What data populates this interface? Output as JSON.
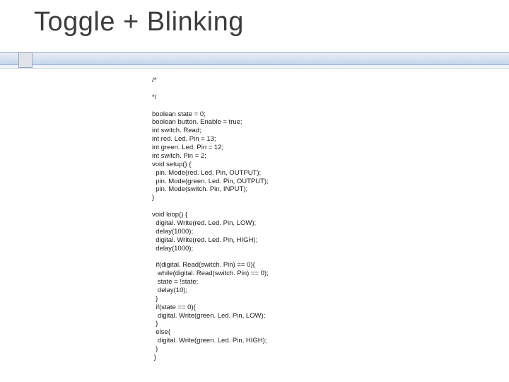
{
  "title": "Toggle + Blinking",
  "code": {
    "l01": "/*",
    "l02": "",
    "l03": "*/",
    "l04": "",
    "l05": "boolean state = 0;",
    "l06": "boolean button. Enable = true;",
    "l07": "int switch. Read;",
    "l08": "int red. Led. Pin = 13;",
    "l09": "int green. Led. Pin = 12;",
    "l10": "int switch. Pin = 2;",
    "l11": "void setup() {",
    "l12": "  pin. Mode(red. Led. Pin, OUTPUT);",
    "l13": "  pin. Mode(green. Led. Pin, OUTPUT);",
    "l14": "  pin. Mode(switch. Pin, INPUT);",
    "l15": "}",
    "l16": "",
    "l17": "void loop() {",
    "l18": "  digital. Write(red. Led. Pin, LOW);",
    "l19": "  delay(1000);",
    "l20": "  digital. Write(red. Led. Pin, HIGH);",
    "l21": "  delay(1000);",
    "l22": "",
    "l23": "  if(digital. Read(switch. Pin) == 0){",
    "l24": "   while(digital. Read(switch. Pin) == 0);",
    "l25": "   state = !state;",
    "l26": "   delay(10);",
    "l27": "  }",
    "l28": "  if(state == 0){",
    "l29": "   digital. Write(green. Led. Pin, LOW);",
    "l30": "  }",
    "l31": "  else{",
    "l32": "   digital. Write(green. Led. Pin, HIGH);",
    "l33": "  }",
    "l34": " }"
  }
}
